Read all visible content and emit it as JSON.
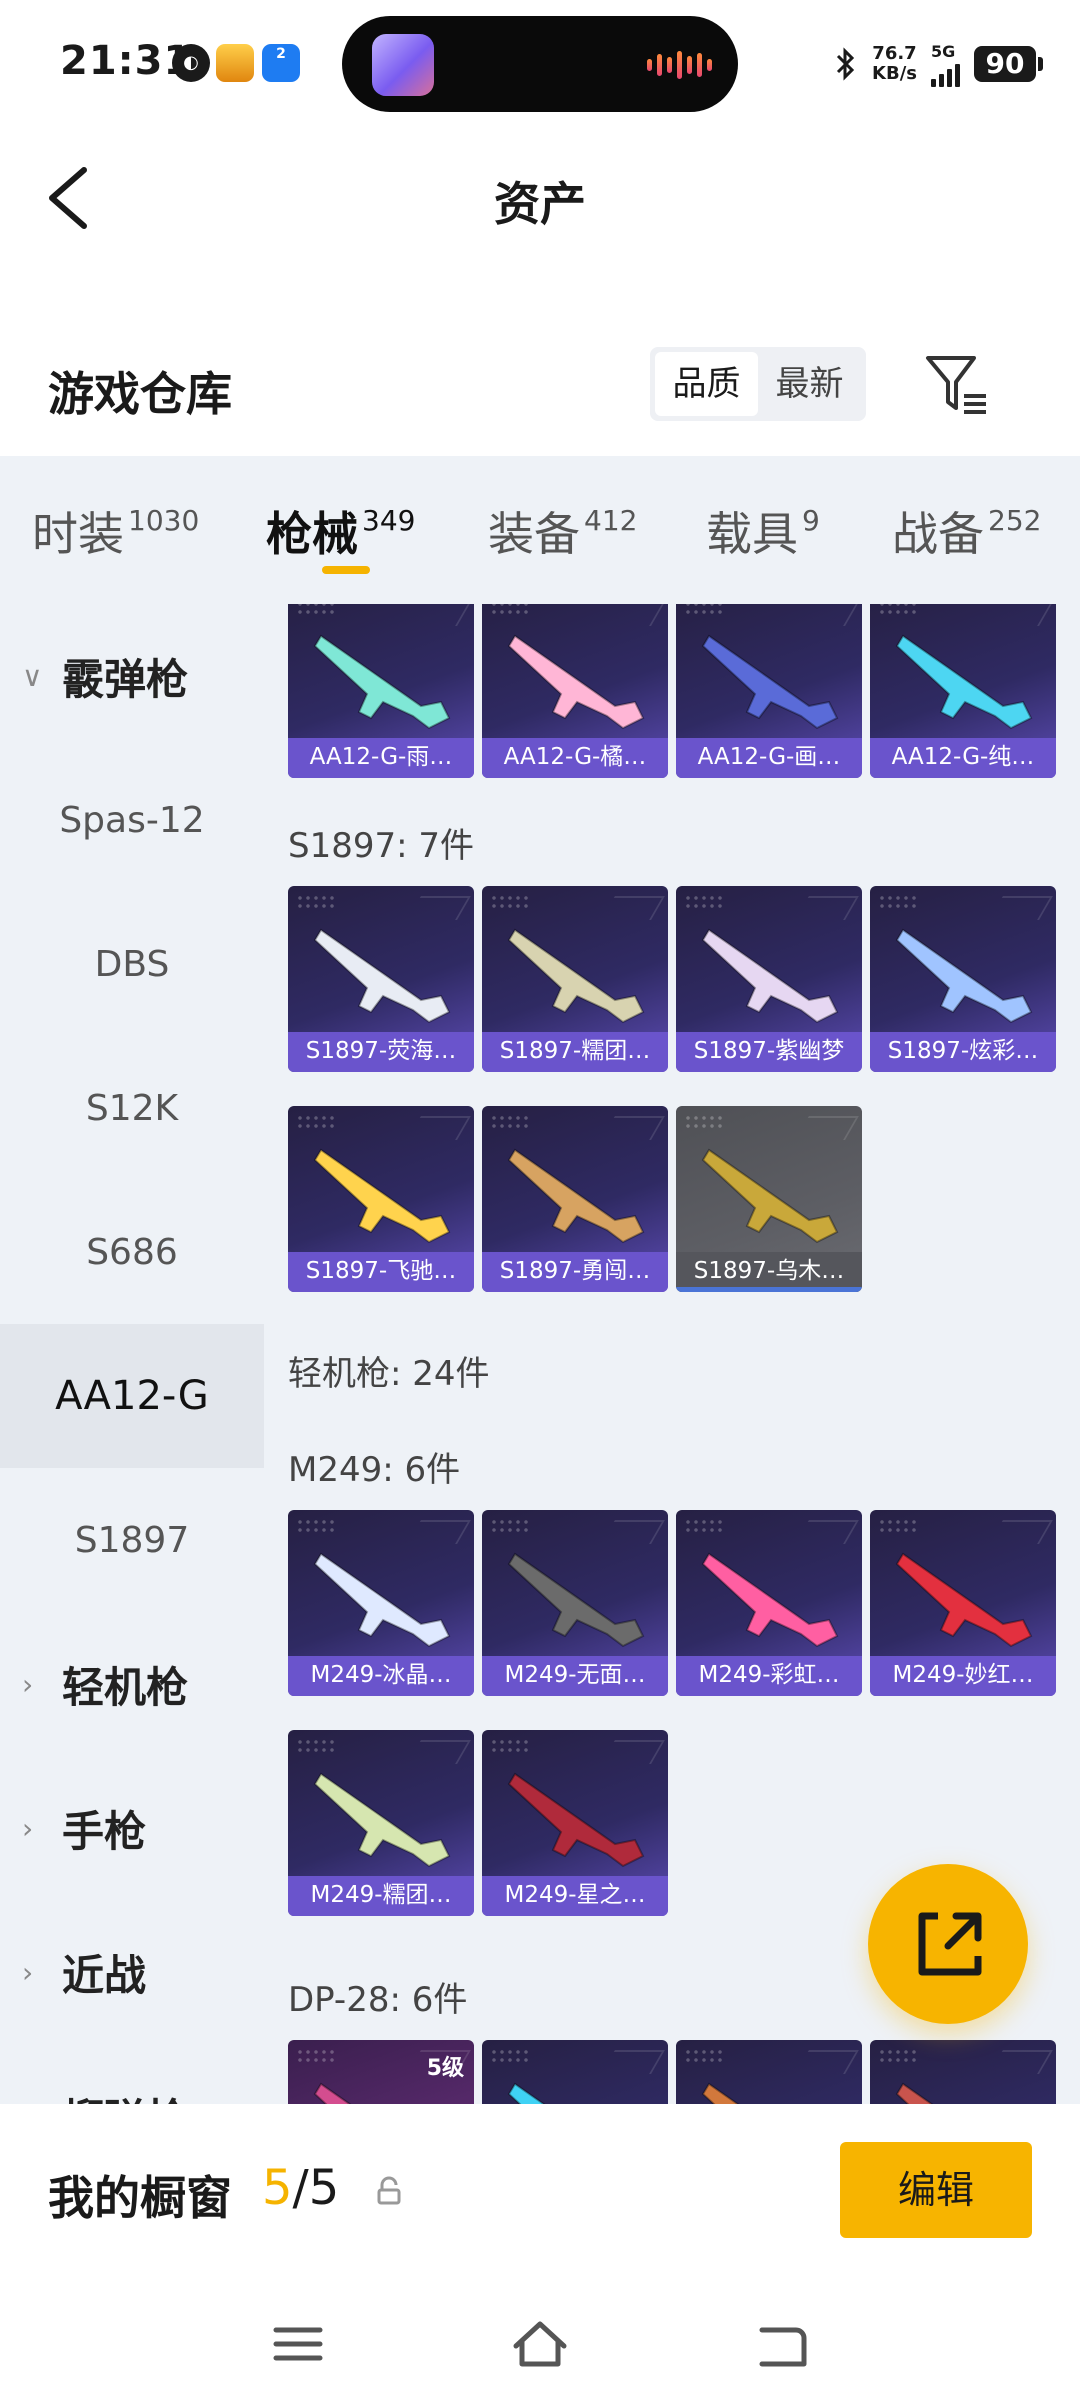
{
  "status_bar": {
    "time": "21:31",
    "net_speed_value": "76.7",
    "net_speed_unit": "KB/s",
    "network": "5G",
    "battery": "90",
    "notif_badge": "2"
  },
  "header": {
    "title": "资产"
  },
  "warehouse": {
    "title": "游戏仓库",
    "sort_options": [
      "品质",
      "最新"
    ],
    "selected_sort": "品质"
  },
  "tabs": [
    {
      "label": "时装",
      "count": "1030"
    },
    {
      "label": "枪械",
      "count": "349",
      "active": true
    },
    {
      "label": "装备",
      "count": "412"
    },
    {
      "label": "载具",
      "count": "9"
    },
    {
      "label": "战备",
      "count": "252"
    }
  ],
  "sidebar": {
    "items": [
      {
        "label": "霰弹枪",
        "type": "group",
        "expanded": true
      },
      {
        "label": "Spas-12"
      },
      {
        "label": "DBS"
      },
      {
        "label": "S12K"
      },
      {
        "label": "S686"
      },
      {
        "label": "AA12-G",
        "selected": true
      },
      {
        "label": "S1897"
      },
      {
        "label": "轻机枪",
        "type": "group"
      },
      {
        "label": "手枪",
        "type": "group"
      },
      {
        "label": "近战",
        "type": "group"
      },
      {
        "label": "榴弹枪",
        "type": "group"
      }
    ]
  },
  "content": {
    "aa12_items": [
      "AA12-G-雨…",
      "AA12-G-橘…",
      "AA12-G-画…",
      "AA12-G-纯…"
    ],
    "s1897_label": "S1897: 7件",
    "s1897_items": [
      "S1897-荧海…",
      "S1897-糯团…",
      "S1897-紫幽梦",
      "S1897-炫彩…",
      "S1897-飞驰…",
      "S1897-勇闯…",
      "S1897-乌木…"
    ],
    "lmg_label": "轻机枪: 24件",
    "m249_label": "M249: 6件",
    "m249_items": [
      "M249-冰晶…",
      "M249-无面…",
      "M249-彩虹…",
      "M249-妙红…",
      "M249-糯团…",
      "M249-星之…"
    ],
    "dp28_label": "DP-28: 6件",
    "dp28_badge": "5级"
  },
  "bottom_bar": {
    "showcase_label": "我的橱窗",
    "showcase_current": "5",
    "showcase_total": "/5",
    "edit_label": "编辑"
  },
  "colors": {
    "accent": "#f7b400",
    "card_bg": "#2f2a63",
    "card_label": "#6a54cc",
    "grey_card": "#5d5e64",
    "panel_bg": "#eef2f7"
  },
  "icons": [
    "back-arrow-icon",
    "filter-icon",
    "share-icon",
    "lock-icon",
    "menu-icon",
    "home-icon",
    "return-icon",
    "bluetooth-icon"
  ]
}
